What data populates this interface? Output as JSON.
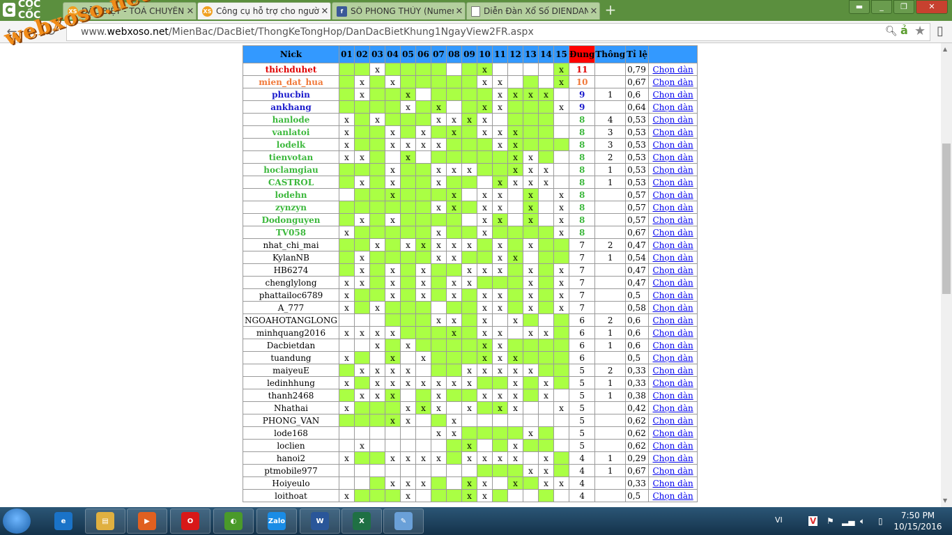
{
  "browser": {
    "logo_text": "CỐC CỐC",
    "tabs": [
      {
        "title": "ĐẶC BIỆT - TOẢ CHUYÊN",
        "favicon": "XS",
        "active": false
      },
      {
        "title": "Công cụ hỗ trợ cho người",
        "favicon": "XS",
        "active": true
      },
      {
        "title": "SỐ PHONG THỦY (Numero",
        "favicon": "f",
        "active": false
      },
      {
        "title": "Diễn Đàn Xổ Số DIENDAN",
        "favicon": "doc",
        "active": false
      }
    ],
    "url_prefix": "www.",
    "url_domain": "webxoso.net",
    "url_path": "/MienBac/DacBiet/ThongKeTongHop/DanDacBietKhung1NgayView2FR.aspx",
    "watermark": "webxoso.net"
  },
  "table": {
    "headers": {
      "nick": "Nick",
      "cols": [
        "01",
        "02",
        "03",
        "04",
        "05",
        "06",
        "07",
        "08",
        "09",
        "10",
        "11",
        "12",
        "13",
        "14",
        "15"
      ],
      "dung": "Đung",
      "thong": "Thông",
      "tile": "Tỉ lệ"
    },
    "link_label": "Chọn dàn",
    "rows": [
      {
        "nick": "thichduhet",
        "rank": 1,
        "g": "110111101100001",
        "x": "001000000100001",
        "dung": "11",
        "thong": "",
        "tile": "0,79"
      },
      {
        "nick": "mien_dat_hua",
        "rank": 2,
        "g": "101011111000101",
        "x": "010100000110001",
        "dung": "10",
        "thong": "",
        "tile": "0,67"
      },
      {
        "nick": "phucbin",
        "rank": 3,
        "g": "101110111101110",
        "x": "010010000011110",
        "dung": "9",
        "thong": "1",
        "tile": "0,6"
      },
      {
        "nick": "ankhang",
        "rank": 3,
        "g": "111101101101110",
        "x": "000010100110001",
        "dung": "9",
        "thong": "",
        "tile": "0,64"
      },
      {
        "nick": "hanlode",
        "rank": 4,
        "g": "010111001001110",
        "x": "101000111100000",
        "dung": "8",
        "thong": "4",
        "tile": "0,53"
      },
      {
        "nick": "vanlatoi",
        "rank": 4,
        "g": "011010111001110",
        "x": "100101010111000",
        "dung": "8",
        "thong": "3",
        "tile": "0,53"
      },
      {
        "nick": "lodelk",
        "rank": 4,
        "g": "011000011101111",
        "x": "100111100011000",
        "dung": "8",
        "thong": "3",
        "tile": "0,53"
      },
      {
        "nick": "tienvotan",
        "rank": 4,
        "g": "001010111111010",
        "x": "110010000001100",
        "dung": "8",
        "thong": "2",
        "tile": "0,53"
      },
      {
        "nick": "hoclamgiau",
        "rank": 4,
        "g": "111011000111000",
        "x": "000100111001110",
        "dung": "8",
        "thong": "1",
        "tile": "0,53"
      },
      {
        "nick": "CASTROL",
        "rank": 4,
        "g": "101011011010000",
        "x": "010100100011110",
        "dung": "8",
        "thong": "1",
        "tile": "0,53"
      },
      {
        "nick": "lodehn",
        "rank": 4,
        "g": "011111110000100",
        "x": "000100010110101",
        "dung": "8",
        "thong": "",
        "tile": "0,57"
      },
      {
        "nick": "zynzyn",
        "rank": 4,
        "g": "111111011000100",
        "x": "000000110110101",
        "dung": "8",
        "thong": "",
        "tile": "0,57"
      },
      {
        "nick": "Dodonguyen",
        "rank": 4,
        "g": "101011110010100",
        "x": "010100000110101",
        "dung": "8",
        "thong": "",
        "tile": "0,57"
      },
      {
        "nick": "TV058",
        "rank": 4,
        "g": "011111011011110",
        "x": "100000100100001",
        "dung": "8",
        "thong": "",
        "tile": "0,67"
      },
      {
        "nick": "nhat_chi_mai",
        "rank": 0,
        "g": "110101000101011",
        "x": "001011111010100",
        "dung": "7",
        "thong": "2",
        "tile": "0,47"
      },
      {
        "nick": "KylanNB",
        "rank": 0,
        "g": "101111001101011",
        "x": "010000110011000",
        "dung": "7",
        "thong": "1",
        "tile": "0,54"
      },
      {
        "nick": "HB6274",
        "rank": 0,
        "g": "101010110001010",
        "x": "010101001110101",
        "dung": "7",
        "thong": "",
        "tile": "0,47"
      },
      {
        "nick": "chenglylong",
        "rank": 0,
        "g": "001010100111010",
        "x": "110101011000101",
        "dung": "7",
        "thong": "",
        "tile": "0,47"
      },
      {
        "nick": "phattailoc6789",
        "rank": 0,
        "g": "011010101001010",
        "x": "100101010110101",
        "dung": "7",
        "thong": "",
        "tile": "0,5"
      },
      {
        "nick": "A_777",
        "rank": 0,
        "g": "010111011001010",
        "x": "101000000110101",
        "dung": "7",
        "thong": "",
        "tile": "0,58"
      },
      {
        "nick": "NGOAHOTANGLONG",
        "rank": 0,
        "g": "000111001000101",
        "x": "000000110101000",
        "dung": "6",
        "thong": "2",
        "tile": "0,6"
      },
      {
        "nick": "minhquang2016",
        "rank": 0,
        "g": "000011111000001",
        "x": "111100010110110",
        "dung": "6",
        "thong": "1",
        "tile": "0,6"
      },
      {
        "nick": "Dacbietdan",
        "rank": 0,
        "g": "000101111101111",
        "x": "001010000110000",
        "dung": "6",
        "thong": "1",
        "tile": "0,6"
      },
      {
        "nick": "tuandung",
        "rank": 0,
        "g": "010100111101111",
        "x": "100101000111000",
        "dung": "6",
        "thong": "",
        "tile": "0,5"
      },
      {
        "nick": "maiyeuE",
        "rank": 0,
        "g": "100000110000011",
        "x": "011110001111100",
        "dung": "5",
        "thong": "2",
        "tile": "0,33"
      },
      {
        "nick": "ledinhhung",
        "rank": 0,
        "g": "010000000110101",
        "x": "101111111001010",
        "dung": "5",
        "thong": "1",
        "tile": "0,33"
      },
      {
        "nick": "thanh2468",
        "rank": 0,
        "g": "100101011000100",
        "x": "011100100111010",
        "dung": "5",
        "thong": "1",
        "tile": "0,38"
      },
      {
        "nick": "Nhathai",
        "rank": 0,
        "g": "011101000110000",
        "x": "100011101011001",
        "dung": "5",
        "thong": "",
        "tile": "0,42"
      },
      {
        "nick": "PHONG_VAN",
        "rank": 0,
        "g": "111100100000000",
        "x": "000110010000000",
        "dung": "5",
        "thong": "",
        "tile": "0,62"
      },
      {
        "nick": "lode168",
        "rank": 0,
        "g": "000000001111010",
        "x": "000000110000100",
        "dung": "5",
        "thong": "",
        "tile": "0,62"
      },
      {
        "nick": "loclien",
        "rank": 0,
        "g": "000000011010110",
        "x": "010000001001000",
        "dung": "5",
        "thong": "",
        "tile": "0,62"
      },
      {
        "nick": "hanoi2",
        "rank": 0,
        "g": "011000010000001",
        "x": "100111101111010",
        "dung": "4",
        "thong": "1",
        "tile": "0,29"
      },
      {
        "nick": "ptmobile977",
        "rank": 0,
        "g": "000000000111001",
        "x": "000000000000110",
        "dung": "4",
        "thong": "1",
        "tile": "0,67"
      },
      {
        "nick": "Hoiyeulo",
        "rank": 0,
        "g": "001000101001100",
        "x": "000111001101011",
        "dung": "4",
        "thong": "",
        "tile": "0,33"
      },
      {
        "nick": "loithoat",
        "rank": 0,
        "g": "011100111010010",
        "x": "100010001100000",
        "dung": "4",
        "thong": "",
        "tile": "0,5"
      }
    ]
  },
  "taskbar": {
    "language": "VI",
    "time": "7:50 PM",
    "date": "10/15/2016",
    "apps": [
      {
        "name": "ie",
        "label": "e",
        "color": "#1a73c8"
      },
      {
        "name": "explorer",
        "label": "▤",
        "color": "#e0b040"
      },
      {
        "name": "media",
        "label": "▶",
        "color": "#e06020"
      },
      {
        "name": "opera",
        "label": "O",
        "color": "#d81818"
      },
      {
        "name": "coccoc",
        "label": "◐",
        "color": "#4a9a2a"
      },
      {
        "name": "zalo",
        "label": "Zalo",
        "color": "#1a8ce6"
      },
      {
        "name": "word",
        "label": "W",
        "color": "#2a5699"
      },
      {
        "name": "excel",
        "label": "X",
        "color": "#1f7044"
      },
      {
        "name": "paint",
        "label": "✎",
        "color": "#6aa0d8"
      }
    ]
  }
}
